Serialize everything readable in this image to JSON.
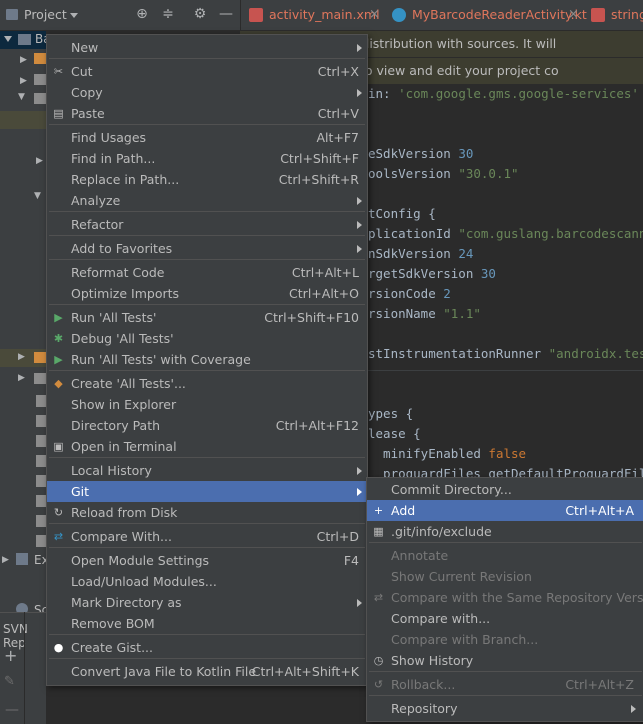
{
  "toolbar": {
    "project_label": "Project",
    "tabs": [
      {
        "label": "activity_main.xml"
      },
      {
        "label": "MyBarcodeReaderActivity.kt"
      },
      {
        "label": "string"
      }
    ]
  },
  "project_tree": {
    "root_label": "Ba",
    "ext_label": "Ex",
    "scratch_label": "Sc",
    "svn_label": "SVN Rep"
  },
  "editor": {
    "notice1": "dle wrapper to use distribution with sources. It will",
    "notice2": "ct Structure dialog to view and edit your project co",
    "lines": [
      {
        "a": "in: ",
        "s": "'com.google.gms.google-services'",
        "b": ""
      },
      {
        "a": "eSdkVersion ",
        "n": "30"
      },
      {
        "a": "oolsVersion ",
        "s": "\"30.0.1\""
      },
      {
        "a": "tConfig {"
      },
      {
        "a": "plicationId ",
        "s": "\"com.guslang.barcodescanner"
      },
      {
        "a": "nSdkVersion ",
        "n": "24"
      },
      {
        "a": "rgetSdkVersion ",
        "n": "30"
      },
      {
        "a": "rsionCode ",
        "n": "2"
      },
      {
        "a": "rsionName ",
        "s": "\"1.1\""
      },
      {
        "a": "stInstrumentationRunner ",
        "s": "\"androidx.test."
      },
      {
        "a": "ypes {"
      },
      {
        "a": "lease {"
      },
      {
        "a": "  minifyEnabled ",
        "k": "false"
      },
      {
        "a": "  proguardFiles getDefaultProguardFile("
      }
    ]
  },
  "context_menu": {
    "items": [
      {
        "label": "New",
        "shortcut": "",
        "arrow": true
      },
      {
        "label": "Cut",
        "shortcut": "Ctrl+X",
        "icon": "scissors-icon"
      },
      {
        "label": "Copy",
        "shortcut": "",
        "arrow": true
      },
      {
        "label": "Paste",
        "shortcut": "Ctrl+V",
        "icon": "clipboard-icon"
      },
      {
        "label": "Find Usages",
        "shortcut": "Alt+F7"
      },
      {
        "label": "Find in Path...",
        "shortcut": "Ctrl+Shift+F"
      },
      {
        "label": "Replace in Path...",
        "shortcut": "Ctrl+Shift+R"
      },
      {
        "label": "Analyze",
        "shortcut": "",
        "arrow": true
      },
      {
        "label": "Refactor",
        "shortcut": "",
        "arrow": true
      },
      {
        "label": "Add to Favorites",
        "shortcut": "",
        "arrow": true
      },
      {
        "label": "Reformat Code",
        "shortcut": "Ctrl+Alt+L"
      },
      {
        "label": "Optimize Imports",
        "shortcut": "Ctrl+Alt+O"
      },
      {
        "label": "Run 'All Tests'",
        "shortcut": "Ctrl+Shift+F10",
        "icon": "run-icon"
      },
      {
        "label": "Debug 'All Tests'",
        "shortcut": "",
        "icon": "debug-icon"
      },
      {
        "label": "Run 'All Tests' with Coverage",
        "shortcut": "",
        "icon": "coverage-icon"
      },
      {
        "label": "Create 'All Tests'...",
        "shortcut": "",
        "icon": "create-test-icon"
      },
      {
        "label": "Show in Explorer",
        "shortcut": ""
      },
      {
        "label": "Directory Path",
        "shortcut": "Ctrl+Alt+F12"
      },
      {
        "label": "Open in Terminal",
        "shortcut": "",
        "icon": "terminal-icon"
      },
      {
        "label": "Local History",
        "shortcut": "",
        "arrow": true
      },
      {
        "label": "Git",
        "shortcut": "",
        "arrow": true
      },
      {
        "label": "Reload from Disk",
        "shortcut": "",
        "icon": "reload-icon"
      },
      {
        "label": "Compare With...",
        "shortcut": "Ctrl+D",
        "icon": "compare-icon"
      },
      {
        "label": "Open Module Settings",
        "shortcut": "F4"
      },
      {
        "label": "Load/Unload Modules...",
        "shortcut": ""
      },
      {
        "label": "Mark Directory as",
        "shortcut": "",
        "arrow": true
      },
      {
        "label": "Remove BOM",
        "shortcut": ""
      },
      {
        "label": "Create Gist...",
        "shortcut": "",
        "icon": "github-icon"
      },
      {
        "label": "Convert Java File to Kotlin File",
        "shortcut": "Ctrl+Alt+Shift+K"
      }
    ]
  },
  "git_submenu": {
    "items": [
      {
        "label": "Commit Directory...",
        "shortcut": ""
      },
      {
        "label": "Add",
        "shortcut": "Ctrl+Alt+A",
        "icon": "plus-icon"
      },
      {
        "label": ".git/info/exclude",
        "shortcut": "",
        "icon": "git-file-icon"
      },
      {
        "label": "Annotate",
        "shortcut": "",
        "disabled": true
      },
      {
        "label": "Show Current Revision",
        "shortcut": "",
        "disabled": true
      },
      {
        "label": "Compare with the Same Repository Version",
        "shortcut": "",
        "disabled": true,
        "icon": "compare-icon"
      },
      {
        "label": "Compare with...",
        "shortcut": ""
      },
      {
        "label": "Compare with Branch...",
        "shortcut": "",
        "disabled": true
      },
      {
        "label": "Show History",
        "shortcut": "",
        "icon": "clock-icon"
      },
      {
        "label": "Rollback...",
        "shortcut": "Ctrl+Alt+Z",
        "disabled": true,
        "icon": "rollback-icon"
      },
      {
        "label": "Repository",
        "shortcut": "",
        "arrow": true
      }
    ]
  },
  "colors": {
    "selection": "#4b6eaf",
    "menu_bg": "#3c3f41",
    "editor_bg": "#2b2b2b"
  }
}
